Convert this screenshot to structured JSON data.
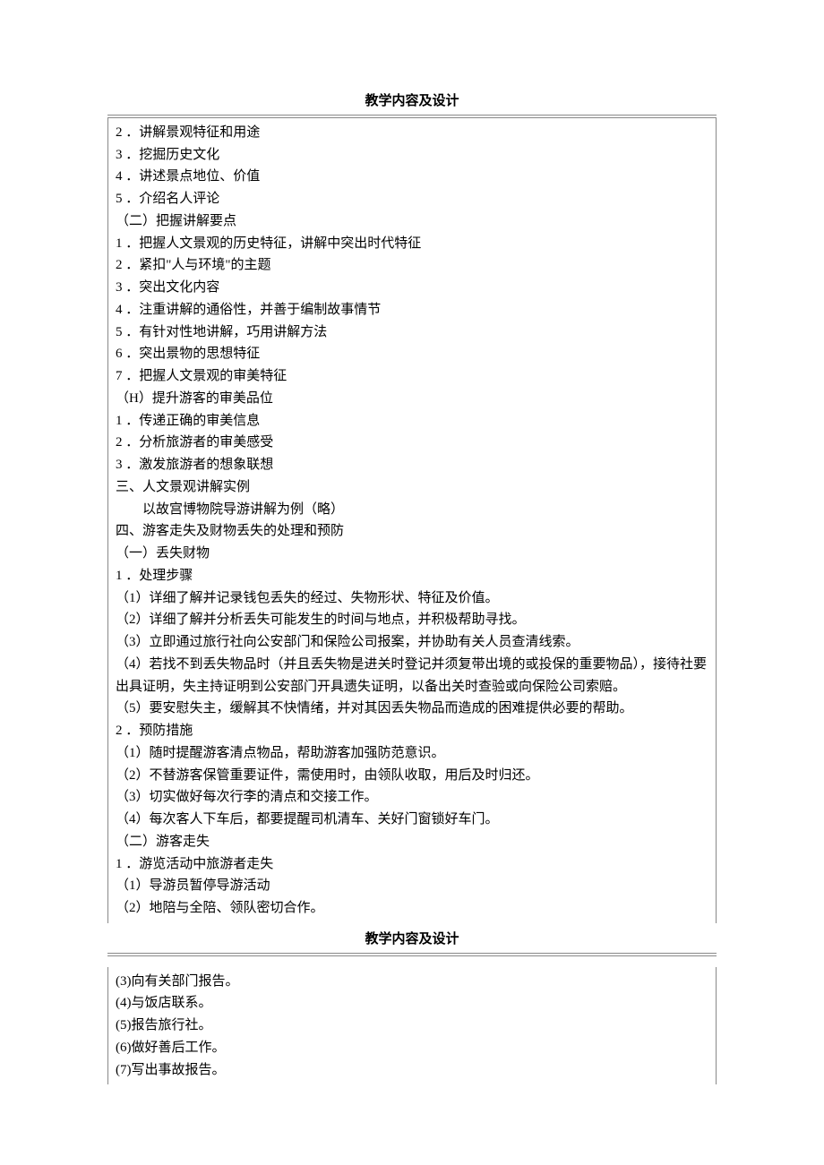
{
  "title1": "教学内容及设计",
  "title2": "教学内容及设计",
  "section1_lines": [
    "2 ．讲解景观特征和用途",
    "3 ．挖掘历史文化",
    "4 ．讲述景点地位、价值",
    "5 ．介绍名人评论",
    "（二）把握讲解要点",
    "1 ．把握人文景观的历史特征，讲解中突出时代特征",
    "2 ．紧扣\"人与环境\"的主题",
    "3 ．突出文化内容",
    "4 ．注重讲解的通俗性，并善于编制故事情节",
    "5 ．有针对性地讲解，巧用讲解方法",
    "6 ．突出景物的思想特征",
    "7 ．把握人文景观的审美特征",
    "（H）提升游客的审美品位",
    "1 ．传递正确的审美信息",
    "2 ．分析旅游者的审美感受",
    "3 ．激发旅游者的想象联想",
    "三、人文景观讲解实例",
    "　　以故宫博物院导游讲解为例（略）",
    "四、游客走失及财物丢失的处理和预防",
    "（一）丢失财物",
    "1 ．处理步骤",
    "（1）详细了解并记录钱包丢失的经过、失物形状、特征及价值。",
    "（2）详细了解并分析丢失可能发生的时间与地点，并积极帮助寻找。",
    "（3）立即通过旅行社向公安部门和保险公司报案，并协助有关人员查清线索。",
    "（4）若找不到丢失物品时（并且丢失物是进关时登记并须复带出境的或投保的重要物品），接待社要出具证明，失主持证明到公安部门开具遗失证明，以备出关时查验或向保险公司索赔。",
    "（5）要安慰失主，缓解其不快情绪，并对其因丢失物品而造成的困难提供必要的帮助。",
    "2 ．预防措施",
    "（1）随时提醒游客清点物品，帮助游客加强防范意识。",
    "（2）不替游客保管重要证件，需使用时，由领队收取，用后及时归还。",
    "（3）切实做好每次行李的清点和交接工作。",
    "（4）每次客人下车后，都要提醒司机清车、关好门窗锁好车门。",
    "（二）游客走失",
    "1 ．游览活动中旅游者走失",
    "（1）导游员暂停导游活动",
    "（2）地陪与全陪、领队密切合作。"
  ],
  "section2_lines": [
    "(3)向有关部门报告。",
    "(4)与饭店联系。",
    "(5)报告旅行社。",
    "(6)做好善后工作。",
    "(7)写出事故报告。"
  ]
}
